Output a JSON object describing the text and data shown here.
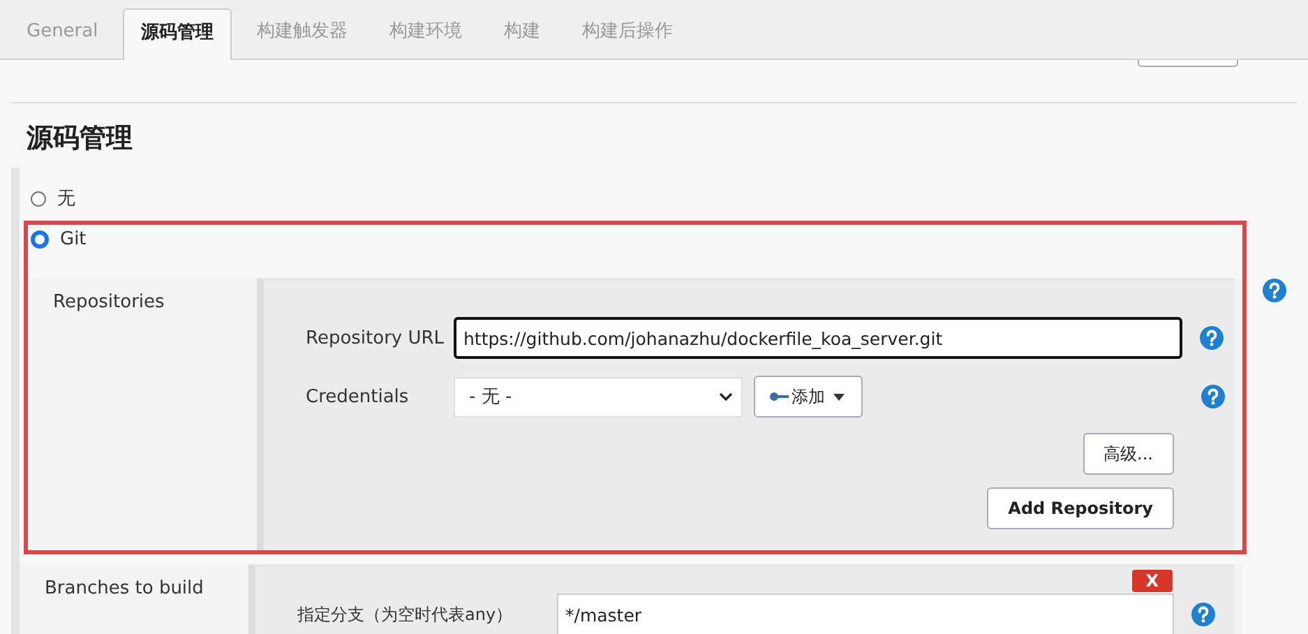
{
  "tabs": [
    {
      "label": "General",
      "selected": false
    },
    {
      "label": "源码管理",
      "selected": true
    },
    {
      "label": "构建触发器",
      "selected": false
    },
    {
      "label": "构建环境",
      "selected": false
    },
    {
      "label": "构建",
      "selected": false
    },
    {
      "label": "构建后操作",
      "selected": false
    }
  ],
  "section_title": "源码管理",
  "scm_options": [
    {
      "label": "无",
      "selected": false
    },
    {
      "label": "Git",
      "selected": true
    }
  ],
  "repositories": {
    "label": "Repositories",
    "url_label": "Repository URL",
    "url_value": "https://github.com/johanazhu/dockerfile_koa_server.git",
    "credentials_label": "Credentials",
    "credentials_value": "- 无 -",
    "add_button": "添加",
    "advanced_button": "高级...",
    "add_repository_button": "Add Repository"
  },
  "branches": {
    "label": "Branches to build",
    "branch_label": "指定分支（为空时代表any）",
    "branch_value": "*/master",
    "delete_button": "X"
  }
}
